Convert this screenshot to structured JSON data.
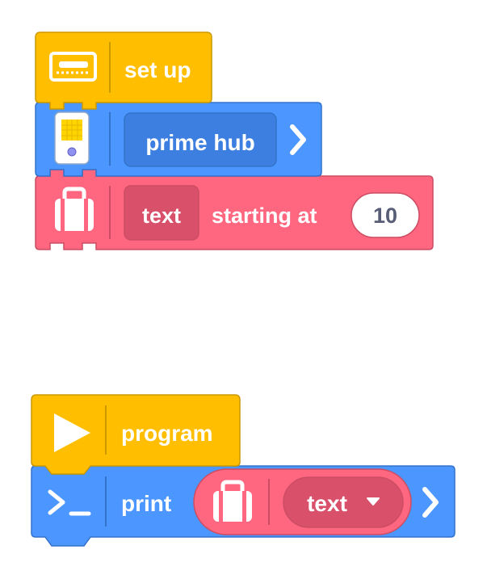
{
  "stack_setup": {
    "hat_label": "set up",
    "hat_icon": "hub-display-icon",
    "hub_block": {
      "selector_label": "prime hub",
      "icon": "prime-hub-icon"
    },
    "var_block": {
      "var_label": "text",
      "mid_label": "starting at",
      "value": "10",
      "icon": "suitcase-icon"
    }
  },
  "stack_program": {
    "hat_label": "program",
    "hat_icon": "play-icon",
    "print_block": {
      "label": "print",
      "icon": "terminal-icon",
      "var_label": "text",
      "var_icon": "suitcase-icon"
    }
  },
  "colors": {
    "yellow": "#FFBF00",
    "yellow_border": "#CC9900",
    "blue": "#4C97FF",
    "blue_border": "#3373CC",
    "blue_dark": "#3D7FE0",
    "pink": "#FF6680",
    "pink_border": "#CC4D63",
    "pink_dark": "#D9506A"
  }
}
